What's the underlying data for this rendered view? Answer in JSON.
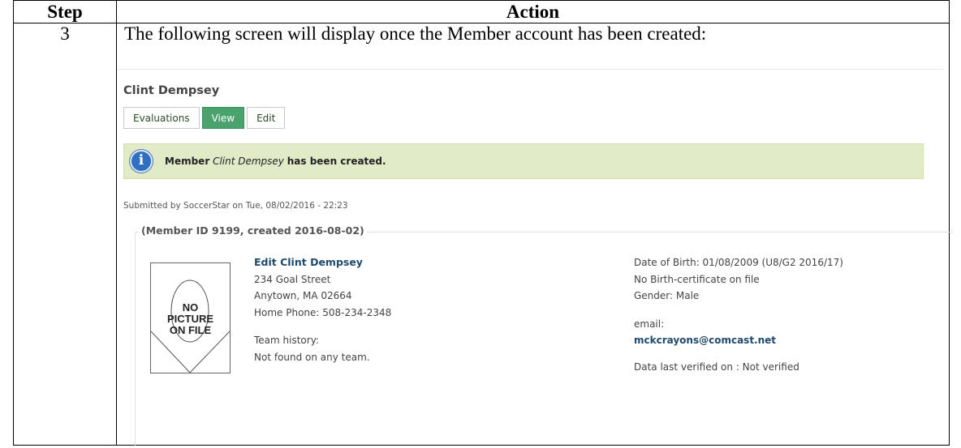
{
  "table": {
    "header_step": "Step",
    "header_action": "Action",
    "step_number": "3",
    "instruction": "The following screen will display once the Member account has been created:"
  },
  "screen": {
    "member_name": "Clint Dempsey",
    "tabs": [
      "Evaluations",
      "View",
      "Edit"
    ],
    "active_tab": "View",
    "message": {
      "prefix": "Member",
      "name": "Clint Dempsey",
      "suffix": "has been created."
    },
    "submitted": "Submitted by SoccerStar on Tue, 08/02/2016 - 22:23",
    "legend": "(Member ID 9199, created 2016-08-02)",
    "picture_placeholder": [
      "NO",
      "PICTURE",
      "ON FILE"
    ],
    "left": {
      "edit_link": "Edit Clint Dempsey",
      "address1": "234 Goal Street",
      "address2": "Anytown, MA 02664",
      "phone": "Home Phone: 508-234-2348",
      "team_history_label": "Team history:",
      "team_history_value": "Not found on any team."
    },
    "right": {
      "dob": "Date of Birth: 01/08/2009 (U8/G2 2016/17)",
      "birth_cert": "No Birth-certificate on file",
      "gender": "Gender: Male",
      "email_label": "email:",
      "email": "mckcrayons@comcast.net",
      "verified": "Data last verified on : Not verified"
    }
  },
  "colors": {
    "active_tab": "#4aa36c",
    "message_bg": "#e1ebc8",
    "info_icon": "#2f6fc1",
    "link": "#1e4a6e"
  }
}
